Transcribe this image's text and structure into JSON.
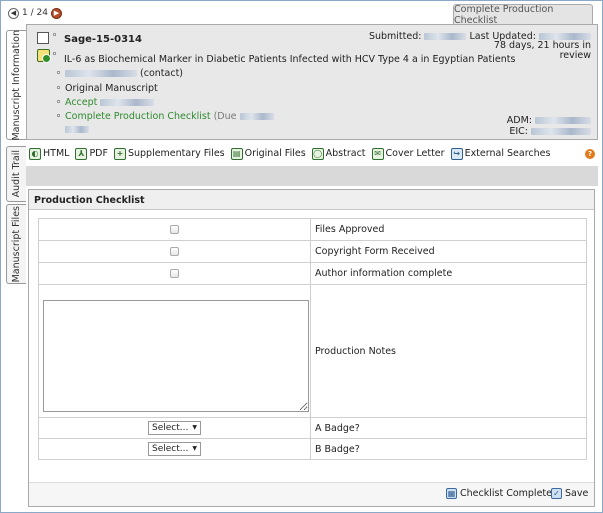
{
  "pager": {
    "text": "1 / 24"
  },
  "top_tab": {
    "label": "Complete Production Checklist"
  },
  "side_tabs": [
    {
      "label": "Manuscript Information"
    },
    {
      "label": "Audit Trail"
    },
    {
      "label": "Manuscript Files"
    }
  ],
  "manuscript": {
    "id": "Sage-15-0314",
    "title": "IL-6 as Biochemical Marker in Diabetic Patients Infected with HCV Type 4 a in Egyptian Patients",
    "submitted_label": "Submitted:",
    "last_updated_label": "Last Updated:",
    "review_time": "78 days, 21 hours in review",
    "contact_suffix": "(contact)",
    "type": "Original Manuscript",
    "accept_label": "Accept",
    "checklist_label": "Complete Production Checklist",
    "due_label": "(Due",
    "adm_label": "ADM:",
    "eic_label": "EIC:"
  },
  "toolbar": {
    "items": [
      {
        "label": "HTML",
        "icon": "html-icon"
      },
      {
        "label": "PDF",
        "icon": "pdf-icon"
      },
      {
        "label": "Supplementary Files",
        "icon": "plus-icon"
      },
      {
        "label": "Original Files",
        "icon": "original-files-icon"
      },
      {
        "label": "Abstract",
        "icon": "abstract-icon"
      },
      {
        "label": "Cover Letter",
        "icon": "cover-letter-icon"
      },
      {
        "label": "External Searches",
        "icon": "external-searches-icon"
      }
    ]
  },
  "checklist": {
    "title": "Production Checklist",
    "rows": [
      {
        "label": "Files Approved"
      },
      {
        "label": "Copyright Form Received"
      },
      {
        "label": "Author information complete"
      }
    ],
    "notes_label": "Production Notes",
    "badges": [
      {
        "label": "A Badge?",
        "selected": "Select..."
      },
      {
        "label": "B Badge?",
        "selected": "Select..."
      }
    ],
    "complete_button": "Checklist Complete",
    "save_button": "Save"
  },
  "colors": {
    "accent_green": "#2f8a2f",
    "frame_blue": "#8aa9c8"
  }
}
